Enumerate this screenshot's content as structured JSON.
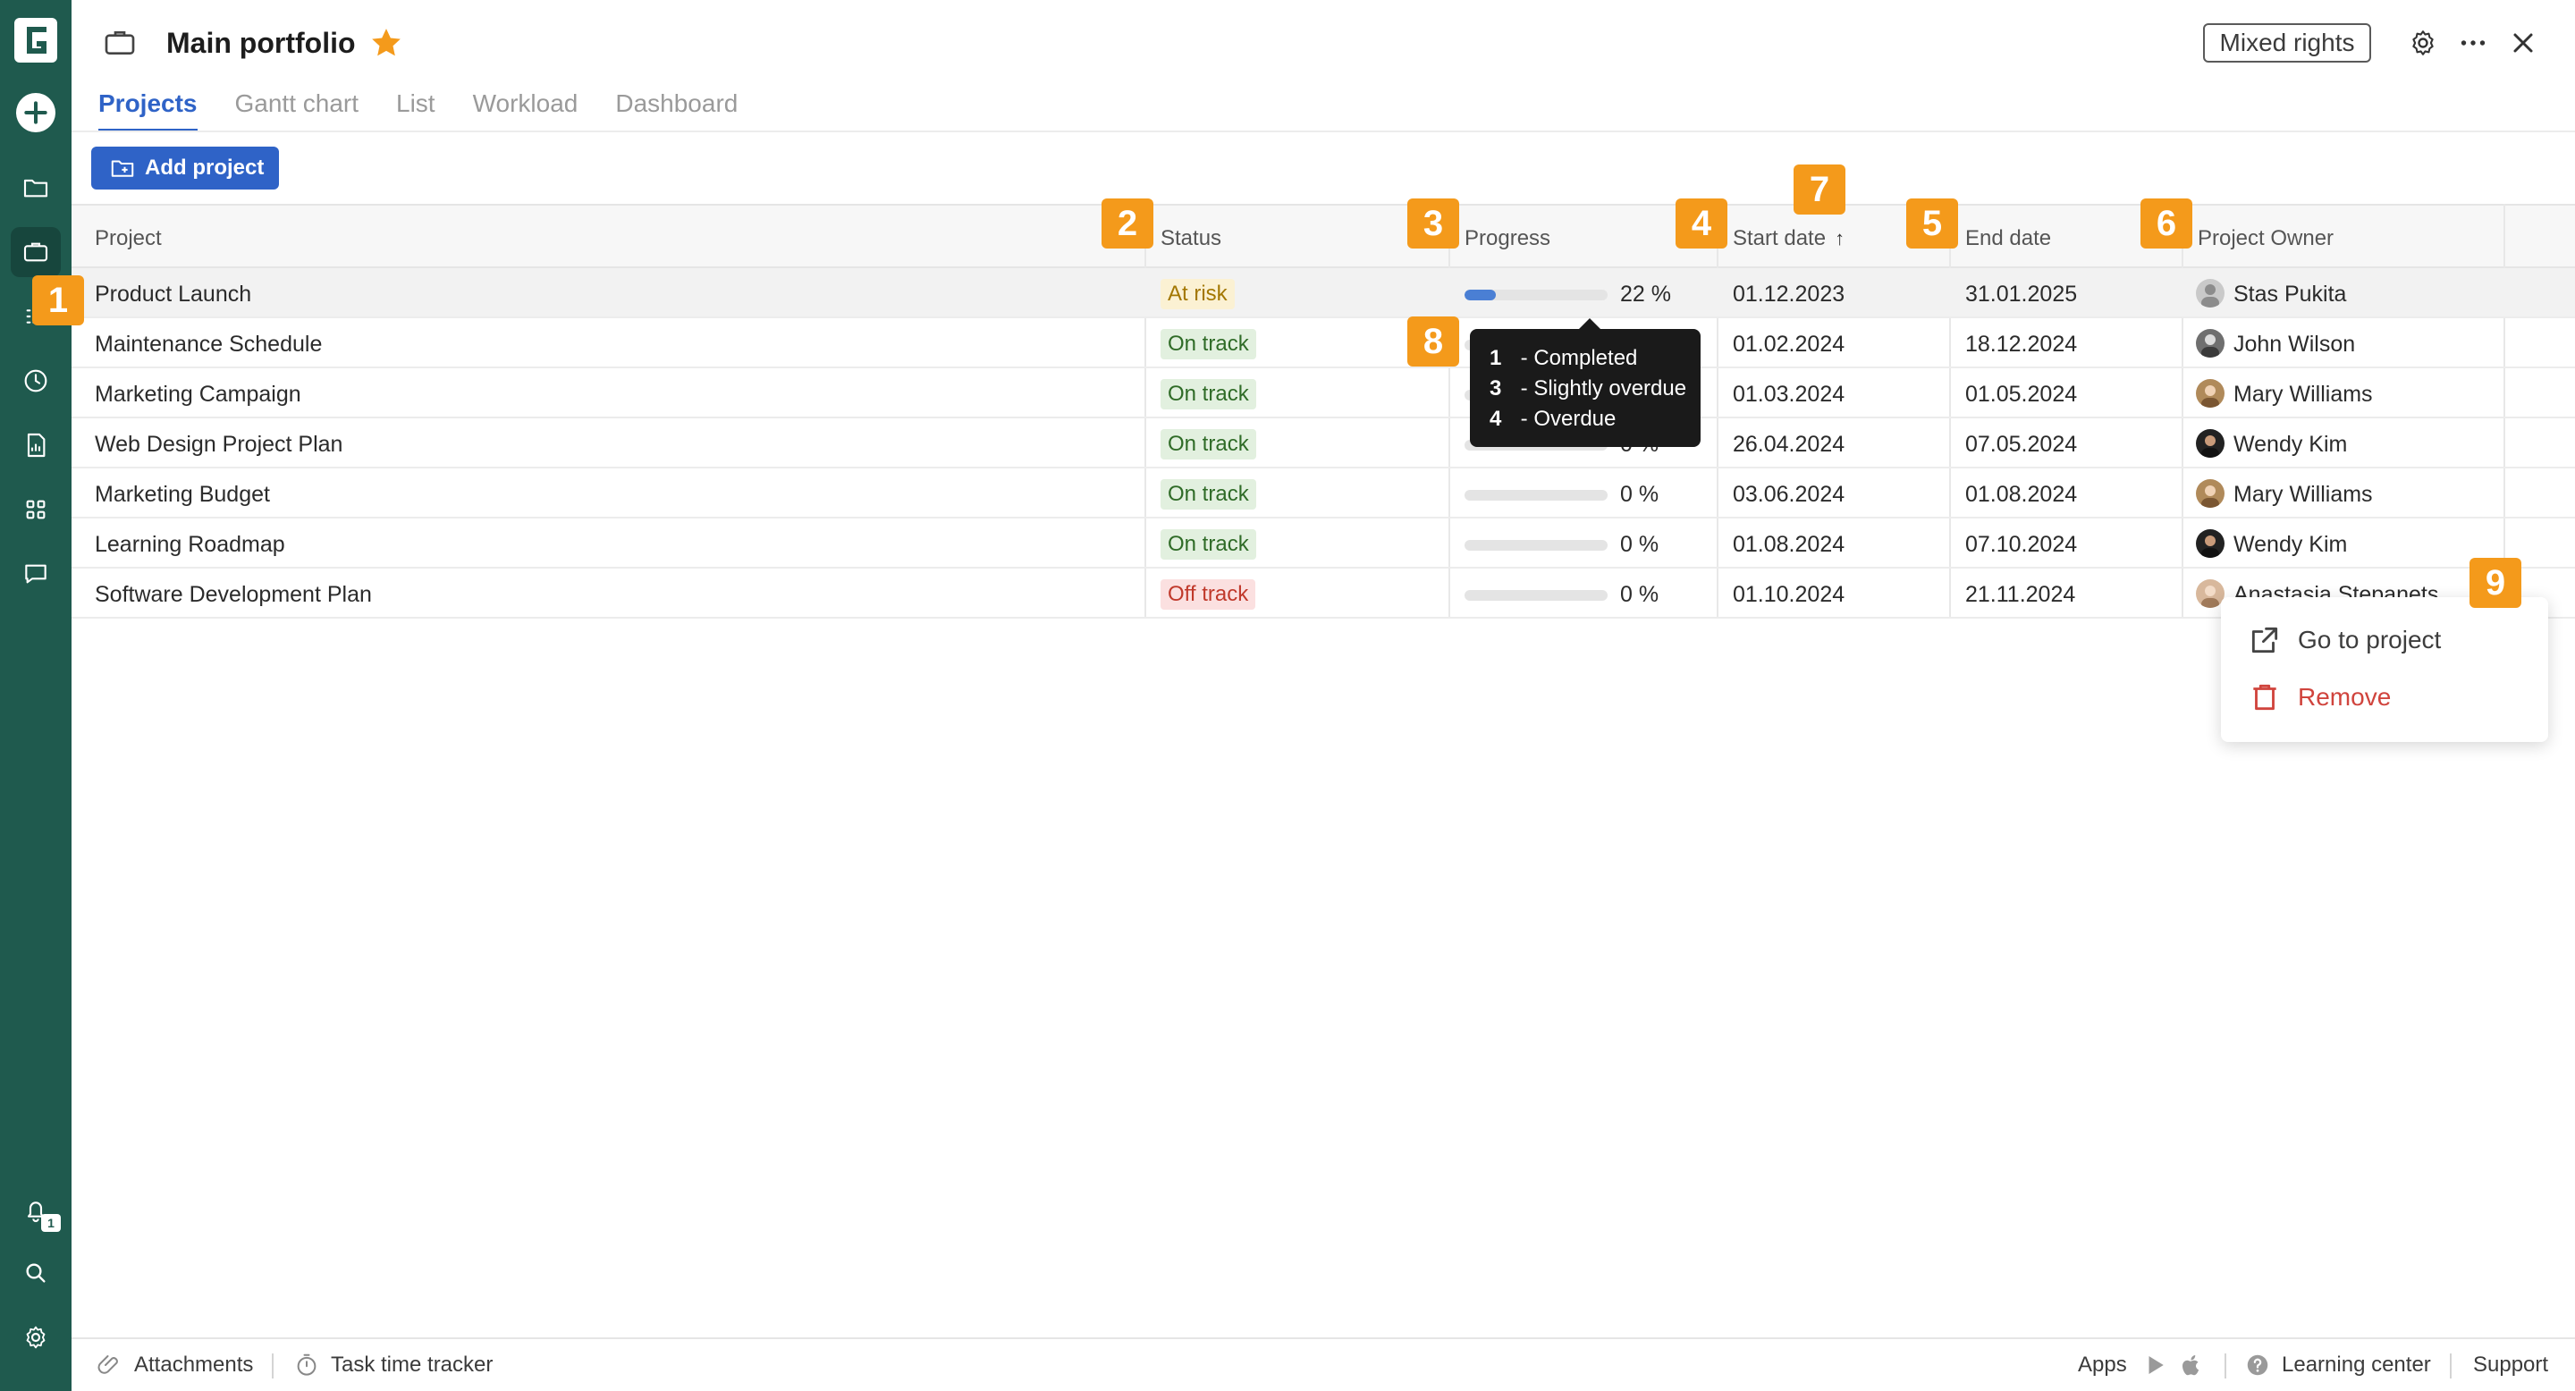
{
  "app": {
    "logo_letter": "G"
  },
  "header": {
    "title": "Main portfolio",
    "rights_button": "Mixed rights"
  },
  "tabs": [
    {
      "label": "Projects",
      "active": true
    },
    {
      "label": "Gantt chart",
      "active": false
    },
    {
      "label": "List",
      "active": false
    },
    {
      "label": "Workload",
      "active": false
    },
    {
      "label": "Dashboard",
      "active": false
    }
  ],
  "toolbar": {
    "add_project": "Add project"
  },
  "table": {
    "columns": [
      "Project",
      "Status",
      "Progress",
      "Start date",
      "End date",
      "Project Owner"
    ],
    "sorted_column": "Start date",
    "sort_direction": "ascending",
    "rows": [
      {
        "project": "Product Launch",
        "status": "At risk",
        "progress": 22,
        "progress_text": "22 %",
        "start": "01.12.2023",
        "end": "31.01.2025",
        "owner": "Stas Pukita"
      },
      {
        "project": "Maintenance Schedule",
        "status": "On track",
        "progress": 0,
        "progress_text": "",
        "start": "01.02.2024",
        "end": "18.12.2024",
        "owner": "John Wilson"
      },
      {
        "project": "Marketing Campaign",
        "status": "On track",
        "progress": 0,
        "progress_text": "",
        "start": "01.03.2024",
        "end": "01.05.2024",
        "owner": "Mary Williams"
      },
      {
        "project": "Web Design Project Plan",
        "status": "On track",
        "progress": 0,
        "progress_text": "0 %",
        "start": "26.04.2024",
        "end": "07.05.2024",
        "owner": "Wendy Kim"
      },
      {
        "project": "Marketing Budget",
        "status": "On track",
        "progress": 0,
        "progress_text": "0 %",
        "start": "03.06.2024",
        "end": "01.08.2024",
        "owner": "Mary Williams"
      },
      {
        "project": "Learning Roadmap",
        "status": "On track",
        "progress": 0,
        "progress_text": "0 %",
        "start": "01.08.2024",
        "end": "07.10.2024",
        "owner": "Wendy Kim"
      },
      {
        "project": "Software Development Plan",
        "status": "Off track",
        "progress": 0,
        "progress_text": "0 %",
        "start": "01.10.2024",
        "end": "21.11.2024",
        "owner": "Anastasia Stepanets"
      }
    ]
  },
  "tooltip": {
    "lines": [
      {
        "count": "1",
        "label": " - Completed"
      },
      {
        "count": "3",
        "label": " - Slightly overdue"
      },
      {
        "count": "4",
        "label": " - Overdue"
      }
    ]
  },
  "context_menu": {
    "go_to_project": "Go to project",
    "remove": "Remove"
  },
  "callouts": [
    "1",
    "2",
    "3",
    "4",
    "5",
    "6",
    "7",
    "8",
    "9"
  ],
  "notifications": {
    "count": "1"
  },
  "footer": {
    "attachments": "Attachments",
    "time_tracker": "Task time tracker",
    "apps": "Apps",
    "learning_center": "Learning center",
    "support": "Support"
  },
  "colors": {
    "rail": "#1f5a4e",
    "accent": "#2f63c7",
    "callout": "#f49a1b",
    "at_risk": "#a37700",
    "on_track": "#2f6b27",
    "off_track": "#c0392b"
  },
  "icons": [
    "logo-icon",
    "plus-icon",
    "folder-icon",
    "briefcase-icon",
    "list-icon",
    "clock-icon",
    "report-icon",
    "grid-icon",
    "chat-icon",
    "bell-icon",
    "search-icon",
    "gear-icon",
    "star-icon",
    "more-icon",
    "close-icon",
    "external-link-icon",
    "trash-icon",
    "paperclip-icon",
    "timer-icon",
    "play-store-icon",
    "apple-icon",
    "help-icon"
  ]
}
